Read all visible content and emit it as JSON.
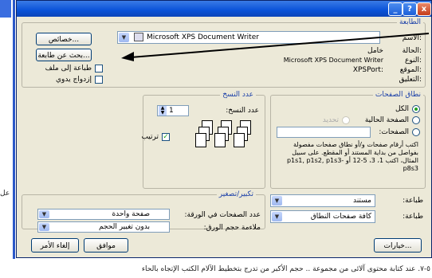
{
  "titlebar": {
    "help": "?",
    "close": "x",
    "min": "_"
  },
  "printer": {
    "group_title": "الطابعة",
    "name_label": "الاسم:",
    "name_value": "Microsoft XPS Document Writer",
    "properties_button": "خصائص...",
    "find_printer_button": "بحث عن طابعة...",
    "print_to_file": "طباعة إلى ملف",
    "manual_duplex": "إزدواج يدوي",
    "status_label": "الحالة:",
    "status_value": "خامل",
    "type_label": "النوع:",
    "type_value": "Microsoft XPS Document Writer",
    "where_label": "الموقع:",
    "where_value": "XPSPort:",
    "comment_label": "التعليق:"
  },
  "page_range": {
    "group_title": "نطاق الصفحات",
    "all": "الكل",
    "current_page": "الصفحة الحالية",
    "selection": "تحديد",
    "pages": "الصفحات:",
    "help_text": "اكتب أرقام صفحات و/أو نطاق صفحات مفصولة بفواصل من بداية المستند أو المقطع. على سبيل المثال، اكتب 1، 3، 5-12 أو p1s1, p1s2, p1s3-p8s3"
  },
  "copies": {
    "group_title": "عدد النسخ",
    "count_label": "عدد النسخ:",
    "count_value": "1",
    "collate": "ترتيب"
  },
  "print_what": {
    "label": "طباعة:",
    "value": "مستند"
  },
  "print_option": {
    "label": "طباعة:",
    "value": "كافة صفحات النطاق"
  },
  "zoom": {
    "group_title": "تكبير/تصغير",
    "pages_per_sheet_label": "عدد الصفحات في الورقة:",
    "pages_per_sheet_value": "صفحة واحدة",
    "scale_label": "ملاءمة حجم الورق:",
    "scale_value": "بدون تغيير الحجم"
  },
  "buttons": {
    "options": "خيارات...",
    "ok": "موافق",
    "cancel": "إلغاء الأمر"
  },
  "side_text": "عل",
  "footer": "٥-٧. عند كتابة محتوى آلائى من مجموعة .. حجم الأكبر من تدرج بتخطيط الآلام الكتب الإتجاه بالحاء"
}
